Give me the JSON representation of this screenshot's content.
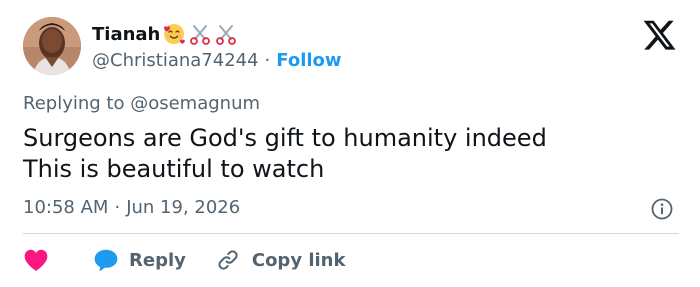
{
  "user": {
    "display_name": "Tianah",
    "handle": "@Christiana74244",
    "separator": "·",
    "follow_label": "Follow",
    "emojis": [
      "smiling-face-with-hearts",
      "scissors",
      "scissors"
    ]
  },
  "reply": {
    "prefix": "Replying to",
    "mention": "@osemagnum"
  },
  "tweet": {
    "line1": "Surgeons are God's gift to humanity indeed",
    "line2": "This is beautiful to watch"
  },
  "meta": {
    "time": "10:58 AM",
    "separator": "·",
    "date": "Jun 19, 2026"
  },
  "actions": {
    "reply_label": "Reply",
    "copy_label": "Copy link"
  },
  "colors": {
    "accent": "#1d9bf0",
    "heart": "#f91880",
    "secondary_text": "#536471",
    "primary_text": "#0f1419",
    "divider": "#cfd9de"
  },
  "icons": [
    "x-logo",
    "heart-icon",
    "reply-bubble-icon",
    "link-icon",
    "info-icon"
  ]
}
